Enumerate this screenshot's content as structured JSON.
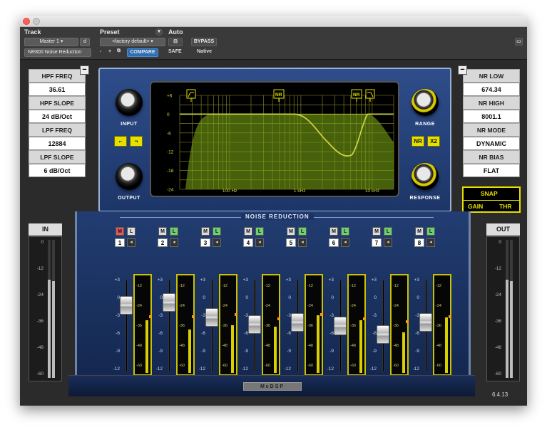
{
  "header": {
    "track_label": "Track",
    "preset_label": "Preset",
    "auto_label": "Auto",
    "track_name": "Master 1",
    "track_mode": "d",
    "plugin_name": "NR800 Noise Reduction",
    "preset_value": "<factory default>",
    "compare_label": "COMPARE",
    "bypass_label": "BYPASS",
    "safe_label": "SAFE",
    "native_label": "Native",
    "minus_sign": "-",
    "plus_sign": "+"
  },
  "left_params": [
    {
      "label": "HPF FREQ",
      "value": "36.61"
    },
    {
      "label": "HPF SLOPE",
      "value": "24 dB/Oct"
    },
    {
      "label": "LPF FREQ",
      "value": "12884"
    },
    {
      "label": "LPF SLOPE",
      "value": "6 dB/Oct"
    }
  ],
  "right_params": [
    {
      "label": "NR LOW",
      "value": "674.34"
    },
    {
      "label": "NR HIGH",
      "value": "8001.1"
    },
    {
      "label": "NR MODE",
      "value": "DYNAMIC"
    },
    {
      "label": "NR BIAS",
      "value": "FLAT"
    }
  ],
  "collapse_symbol": "−",
  "knobs": {
    "input": "INPUT",
    "output": "OUTPUT",
    "range": "RANGE",
    "response": "RESPONSE"
  },
  "buttons": {
    "nr": "NR",
    "x2": "X2",
    "snap": "SNAP",
    "gain": "GAIN",
    "thr": "THR"
  },
  "eq": {
    "y_ticks": [
      "+6",
      "0",
      "-6",
      "-12",
      "-18",
      "-24"
    ],
    "x_ticks": [
      "100 Hz",
      "1 kHz",
      "10 kHz"
    ],
    "marker_nr": "NR"
  },
  "section_title": "NOISE REDUCTION",
  "meters": {
    "in_label": "IN",
    "out_label": "OUT",
    "scale": [
      "0",
      "-12",
      "-24",
      "-36",
      "-48",
      "-60"
    ]
  },
  "fader_scale": [
    "+3",
    "0",
    "-3",
    "-6",
    "-9",
    "-12"
  ],
  "meter_scale": [
    "-12",
    "-24",
    "-36",
    "-48",
    "-60"
  ],
  "channels": [
    {
      "number": "1",
      "m": "M",
      "l": "L",
      "m_active": true,
      "fader": 0.22,
      "level": 0.55,
      "peak": 0.6
    },
    {
      "number": "2",
      "m": "M",
      "l": "L",
      "m_active": false,
      "fader": 0.18,
      "level": 0.45,
      "peak": 0.6
    },
    {
      "number": "3",
      "m": "M",
      "l": "L",
      "m_active": false,
      "fader": 0.38,
      "level": 0.5,
      "peak": 0.62
    },
    {
      "number": "4",
      "m": "M",
      "l": "L",
      "m_active": false,
      "fader": 0.48,
      "level": 0.48,
      "peak": 0.58
    },
    {
      "number": "5",
      "m": "M",
      "l": "L",
      "m_active": false,
      "fader": 0.45,
      "level": 0.6,
      "peak": 0.62
    },
    {
      "number": "6",
      "m": "M",
      "l": "L",
      "m_active": false,
      "fader": 0.5,
      "level": 0.55,
      "peak": 0.58
    },
    {
      "number": "7",
      "m": "M",
      "l": "L",
      "m_active": false,
      "fader": 0.62,
      "level": 0.42,
      "peak": 0.55
    },
    {
      "number": "8",
      "m": "M",
      "l": "L",
      "m_active": false,
      "fader": 0.45,
      "level": 0.58,
      "peak": 0.6
    }
  ],
  "version": "6.4.13",
  "colors": {
    "accent": "#e6e000",
    "panel": "#223d72",
    "mute_active": "#e85a5a",
    "link": "#6fd06f"
  }
}
